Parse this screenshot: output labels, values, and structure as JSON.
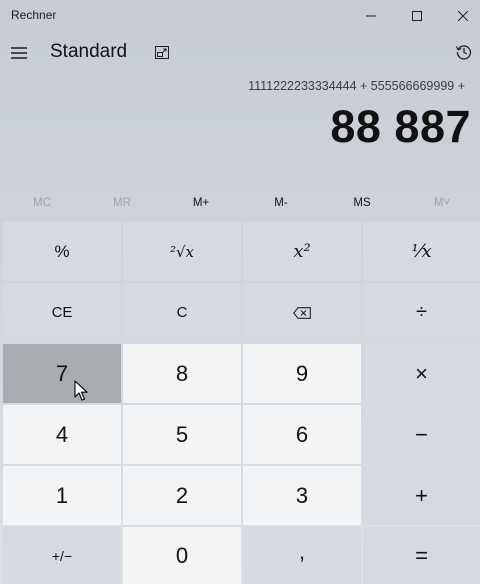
{
  "window": {
    "title": "Rechner"
  },
  "header": {
    "mode": "Standard"
  },
  "display": {
    "expression": "1111222233334444 + 555566669999 +",
    "result": "88 887"
  },
  "memory": [
    {
      "label": "MC",
      "enabled": false
    },
    {
      "label": "MR",
      "enabled": false
    },
    {
      "label": "M+",
      "enabled": true
    },
    {
      "label": "M-",
      "enabled": true
    },
    {
      "label": "MS",
      "enabled": true
    },
    {
      "label": "M˅",
      "enabled": false
    }
  ],
  "keys": {
    "percent": "%",
    "sqrt": "²√x",
    "square": "x²",
    "reciprocal": "⅟x",
    "ce": "CE",
    "c": "C",
    "backspace": "backspace-icon",
    "divide": "÷",
    "seven": "7",
    "eight": "8",
    "nine": "9",
    "multiply": "×",
    "four": "4",
    "five": "5",
    "six": "6",
    "minus": "−",
    "one": "1",
    "two": "2",
    "three": "3",
    "plus": "+",
    "negate": "+/−",
    "zero": "0",
    "decimal": ",",
    "equals": "="
  },
  "colors": {
    "operator_key": "#d6dae0",
    "number_key": "#f3f4f6",
    "hovered_key": "#a9adb2"
  }
}
